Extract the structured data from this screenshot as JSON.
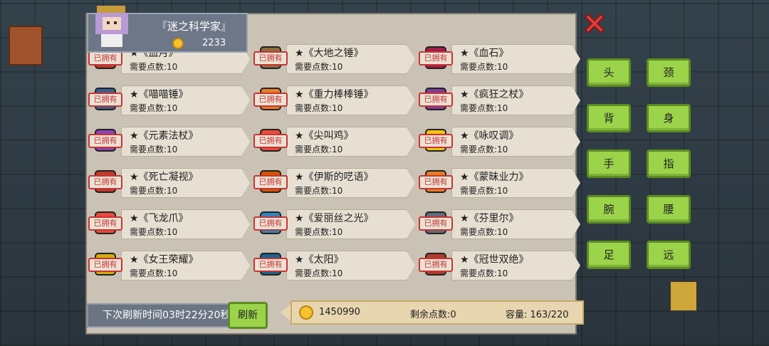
{
  "shop": {
    "title": "『迷之科学家』",
    "gold": "2233",
    "owned_label": "已拥有",
    "items": [
      {
        "name": "★《血月》",
        "cost": "需要点数:10",
        "icon": "blood-moon-icon",
        "color": "#c0392b"
      },
      {
        "name": "★《大地之锤》",
        "cost": "需要点数:10",
        "icon": "earth-hammer-icon",
        "color": "#8e6b3e"
      },
      {
        "name": "★《血石》",
        "cost": "需要点数:10",
        "icon": "blood-stone-icon",
        "color": "#a31d4a"
      },
      {
        "name": "★《喵喵锤》",
        "cost": "需要点数:10",
        "icon": "meow-hammer-icon",
        "color": "#3a5f8f"
      },
      {
        "name": "★《重力棒棒锤》",
        "cost": "需要点数:10",
        "icon": "gravity-lollipop-hammer-icon",
        "color": "#e67e22"
      },
      {
        "name": "★《疯狂之杖》",
        "cost": "需要点数:10",
        "icon": "mad-staff-icon",
        "color": "#7d3c98"
      },
      {
        "name": "★《元素法杖》",
        "cost": "需要点数:10",
        "icon": "elemental-staff-icon",
        "color": "#8e44ad"
      },
      {
        "name": "★《尖叫鸡》",
        "cost": "需要点数:10",
        "icon": "screaming-chicken-icon",
        "color": "#e74c3c"
      },
      {
        "name": "★《咏叹调》",
        "cost": "需要点数:10",
        "icon": "aria-icon",
        "color": "#f1c40f"
      },
      {
        "name": "★《死亡凝视》",
        "cost": "需要点数:10",
        "icon": "death-gaze-icon",
        "color": "#c0392b"
      },
      {
        "name": "★《伊斯的呓语》",
        "cost": "需要点数:10",
        "icon": "ys-whisper-icon",
        "color": "#d35400"
      },
      {
        "name": "★《蒙昧业力》",
        "cost": "需要点数:10",
        "icon": "ignorant-karma-icon",
        "color": "#e67e22"
      },
      {
        "name": "★《飞龙爪》",
        "cost": "需要点数:10",
        "icon": "dragon-claw-icon",
        "color": "#e74c3c"
      },
      {
        "name": "★《爱丽丝之光》",
        "cost": "需要点数:10",
        "icon": "alice-light-icon",
        "color": "#2e86c1"
      },
      {
        "name": "★《芬里尔》",
        "cost": "需要点数:10",
        "icon": "fenrir-icon",
        "color": "#5d6d7e"
      },
      {
        "name": "★《女王荣耀》",
        "cost": "需要点数:10",
        "icon": "queen-glory-icon",
        "color": "#d4ac0d"
      },
      {
        "name": "★《太阳》",
        "cost": "需要点数:10",
        "icon": "sun-icon",
        "color": "#1f618d"
      },
      {
        "name": "★《冠世双绝》",
        "cost": "需要点数:10",
        "icon": "peerless-duo-icon",
        "color": "#b03a2e"
      }
    ]
  },
  "slots": [
    "头",
    "颈",
    "背",
    "身",
    "手",
    "指",
    "腕",
    "腰",
    "足",
    "远"
  ],
  "footer": {
    "refresh_time": "下次刷新时间03时22分20秒",
    "refresh_button": "刷新",
    "gold": "1450990",
    "points": "剩余点数:0",
    "capacity": "容量: 163/220"
  },
  "colors": {
    "button_green": "#9bd34a",
    "owned_red": "#cc3333",
    "panel": "#c9c2b5"
  }
}
